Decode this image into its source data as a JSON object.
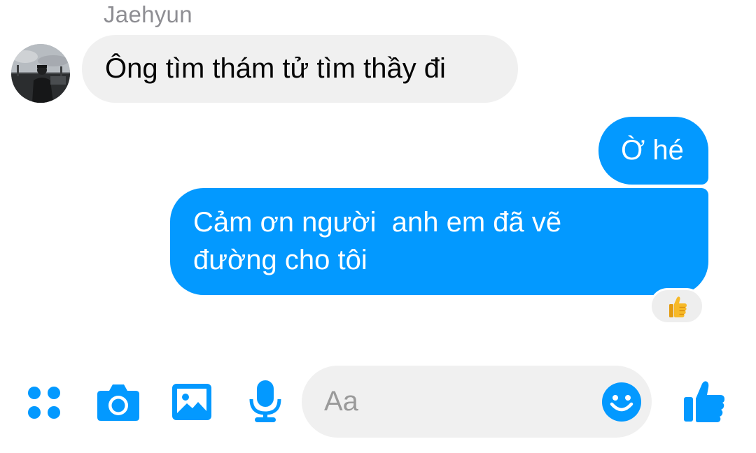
{
  "thread": {
    "contact_name": "Jaehyun"
  },
  "messages": [
    {
      "direction": "incoming",
      "text": "Ông tìm thám tử tìm thầy đi"
    },
    {
      "direction": "outgoing",
      "text": "Ờ hé"
    },
    {
      "direction": "outgoing",
      "lines": [
        "Cảm ơn người  anh em đã vẽ",
        "đường cho tôi"
      ],
      "reaction": "thumbs-up-emoji"
    }
  ],
  "composer": {
    "placeholder": "Aa",
    "value": "",
    "icons": [
      "more-apps-icon",
      "camera-icon",
      "gallery-icon",
      "microphone-icon",
      "emoji-icon",
      "thumbs-up-icon"
    ]
  },
  "colors": {
    "accent": "#0399ff",
    "incoming_bubble": "#f0f0f0",
    "sender_name": "#8e8e93"
  }
}
